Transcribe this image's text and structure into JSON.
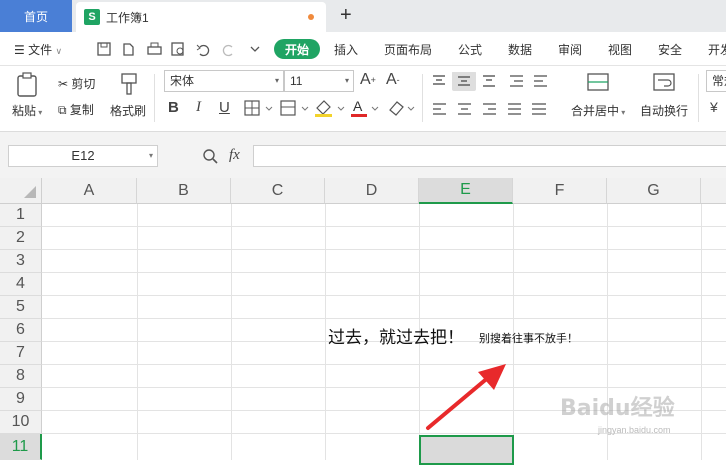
{
  "tabs": {
    "home": "首页",
    "doc": "工作簿1",
    "new": "+"
  },
  "menu": {
    "file": "文件",
    "start": "开始",
    "insert": "插入",
    "layout": "页面布局",
    "formula": "公式",
    "data": "数据",
    "review": "审阅",
    "view": "视图",
    "security": "安全",
    "dev": "开发"
  },
  "ribbon": {
    "paste": "粘贴",
    "cut": "剪切",
    "copy": "复制",
    "format_painter": "格式刷",
    "font_name": "宋体",
    "font_size": "11",
    "merge": "合并居中",
    "wrap": "自动换行",
    "number_format": "常规"
  },
  "formula_bar": {
    "name_box": "E12",
    "fx": "fx"
  },
  "grid": {
    "columns": [
      "A",
      "B",
      "C",
      "D",
      "E",
      "F",
      "G"
    ],
    "rows": [
      "1",
      "2",
      "3",
      "4",
      "5",
      "6",
      "7",
      "8",
      "9",
      "10",
      "11"
    ]
  },
  "cells": {
    "d6": "过去，就过去把！",
    "e6": "别搜着往事不放手！"
  },
  "watermark": {
    "brand": "Baidu经验",
    "url": "jingyan.baidu.com"
  },
  "colors": {
    "accent": "#1fa463",
    "home_tab": "#4a7fd6",
    "selection": "#1e9a4a",
    "arrow": "#e8292b"
  }
}
